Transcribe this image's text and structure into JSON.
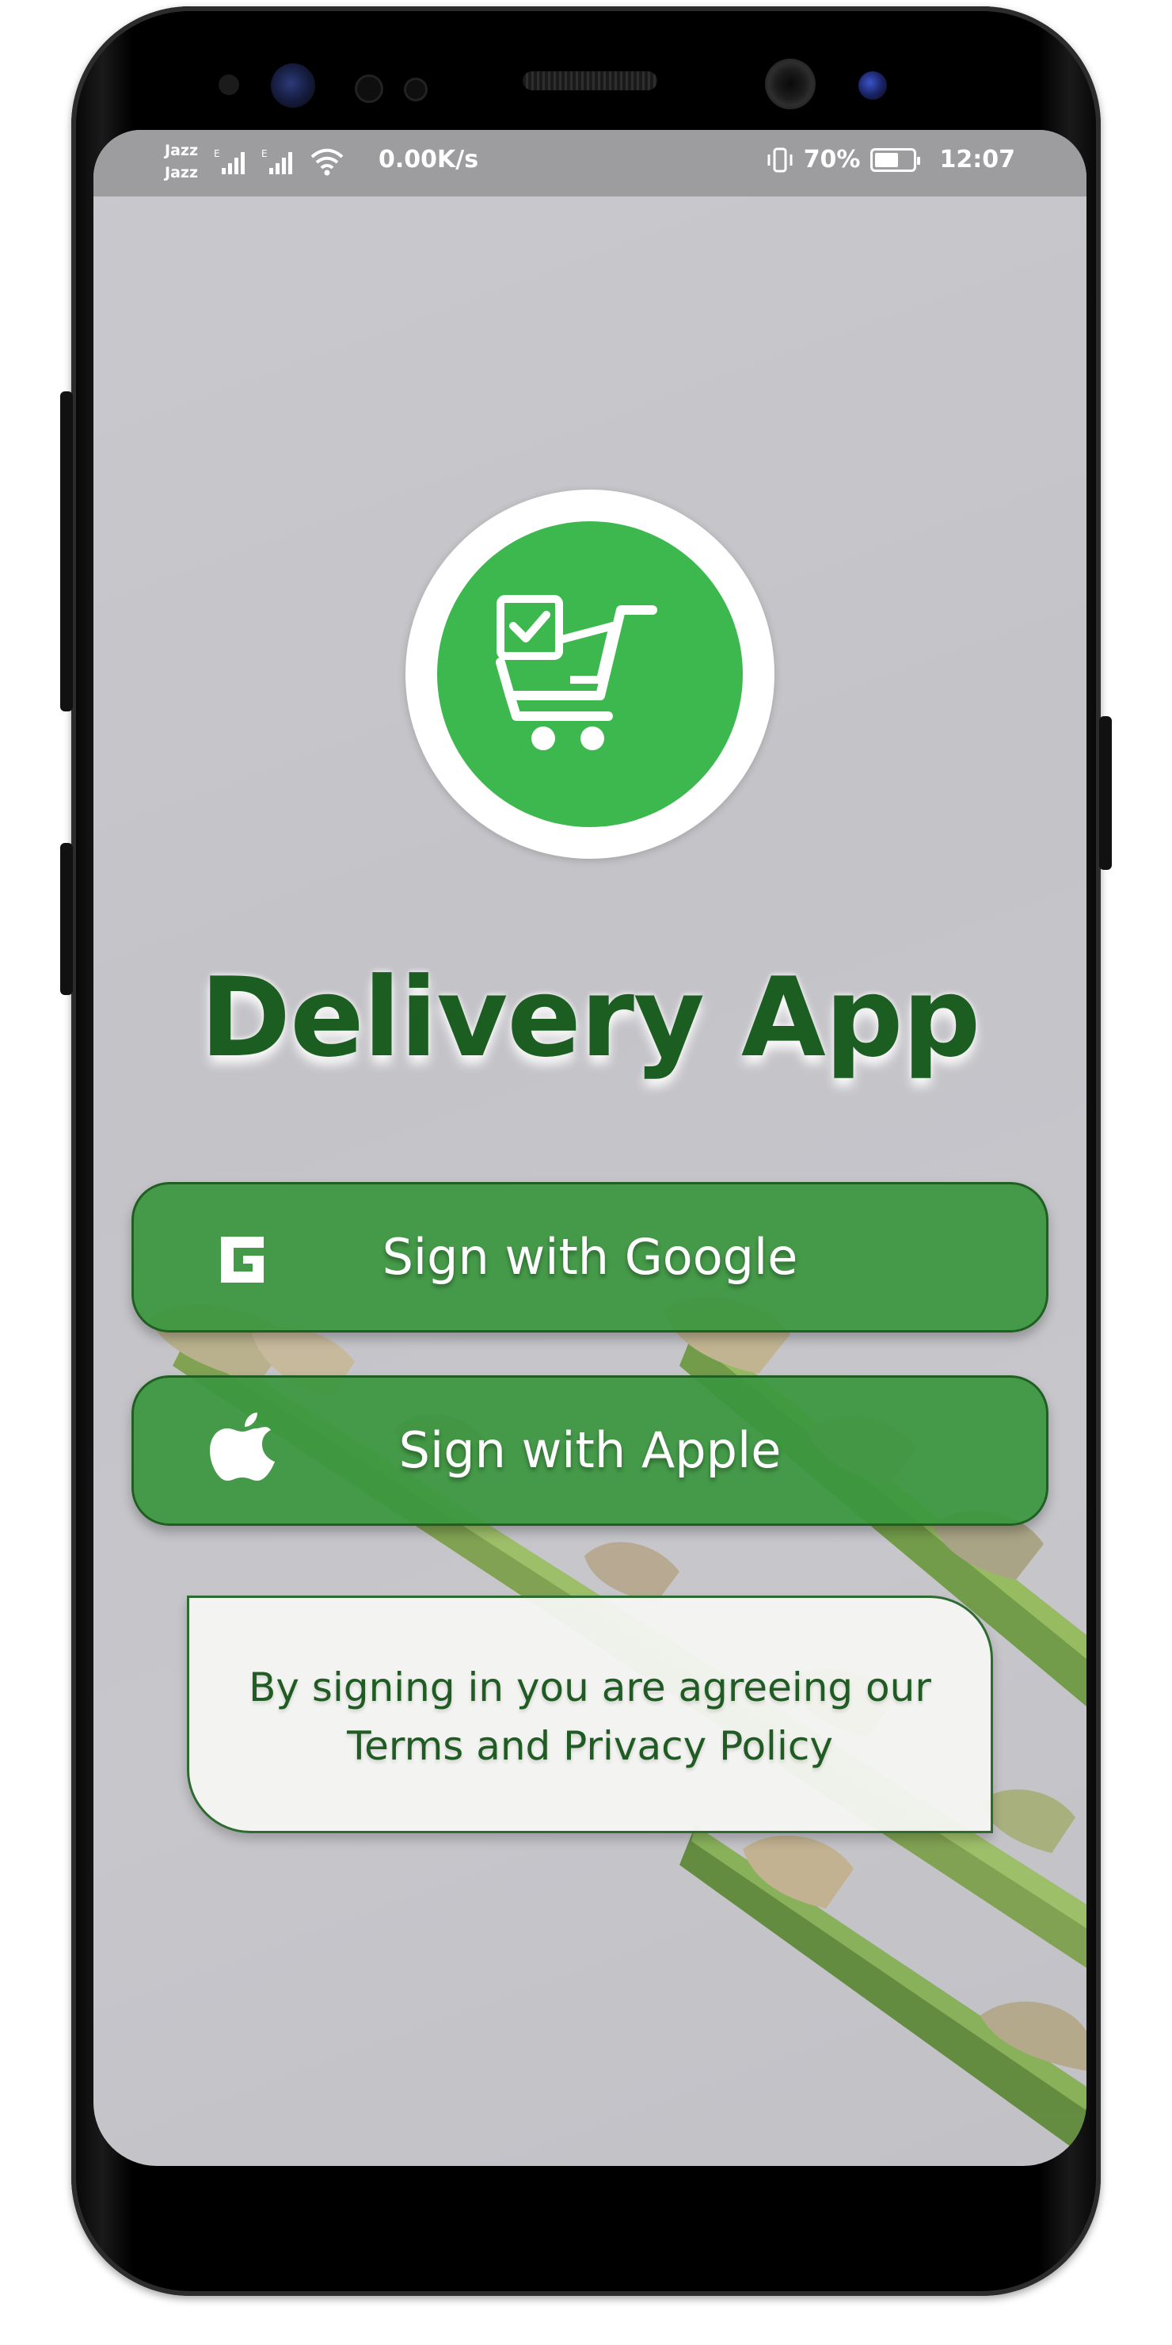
{
  "status_bar": {
    "carrier_top": "Jazz",
    "carrier_bottom": "Jazz",
    "net_speed": "0.00K/s",
    "battery_percent": "70%",
    "battery_level": 0.7,
    "time": "12:07",
    "icons": [
      "signal-icon",
      "signal-icon",
      "wifi-icon",
      "vibrate-icon",
      "battery-icon"
    ]
  },
  "app": {
    "title": "Delivery App",
    "logo_icon": "shopping-cart-check-icon"
  },
  "buttons": {
    "google": {
      "label": "Sign with Google",
      "icon": "google-icon"
    },
    "apple": {
      "label": "Sign with Apple",
      "icon": "apple-icon"
    }
  },
  "terms": {
    "line1": "By signing in you are agreeing our",
    "line2": "Terms and Privacy Policy"
  },
  "colors": {
    "brand_green": "#3cb84e",
    "button_green": "#3a963e",
    "title_green": "#1c5e21",
    "status_bar": "#9d9d9f"
  }
}
